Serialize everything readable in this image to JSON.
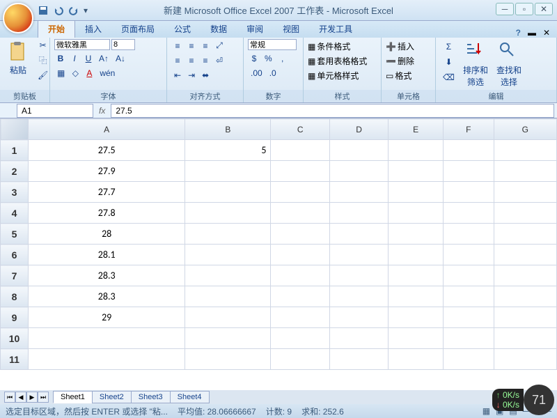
{
  "window": {
    "title": "新建 Microsoft Office Excel 2007 工作表 - Microsoft Excel"
  },
  "tabs": {
    "items": [
      "开始",
      "插入",
      "页面布局",
      "公式",
      "数据",
      "审阅",
      "视图",
      "开发工具"
    ],
    "active": 0
  },
  "ribbon": {
    "clipboard": {
      "label": "剪贴板",
      "paste": "粘贴"
    },
    "font": {
      "label": "字体",
      "name": "微软雅黑",
      "size": "8"
    },
    "align": {
      "label": "对齐方式"
    },
    "number": {
      "label": "数字",
      "format": "常规"
    },
    "styles": {
      "label": "样式",
      "cond": "条件格式",
      "table": "套用表格格式",
      "cell": "单元格样式"
    },
    "cells": {
      "label": "单元格",
      "insert": "插入",
      "delete": "删除",
      "format": "格式"
    },
    "editing": {
      "label": "编辑",
      "sort": "排序和\n筛选",
      "find": "查找和\n选择"
    }
  },
  "namebox": "A1",
  "formula": "27.5",
  "columns": [
    "A",
    "B",
    "C",
    "D",
    "E",
    "F",
    "G"
  ],
  "rows": [
    {
      "n": 1,
      "A": "27.5",
      "B": "5"
    },
    {
      "n": 2,
      "A": "27.9"
    },
    {
      "n": 3,
      "A": "27.7"
    },
    {
      "n": 4,
      "A": "27.8"
    },
    {
      "n": 5,
      "A": "28"
    },
    {
      "n": 6,
      "A": "28.1"
    },
    {
      "n": 7,
      "A": "28.3"
    },
    {
      "n": 8,
      "A": "28.3"
    },
    {
      "n": 9,
      "A": "29"
    },
    {
      "n": 10
    },
    {
      "n": 11
    }
  ],
  "sheets": [
    "Sheet1",
    "Sheet2",
    "Sheet3",
    "Sheet4"
  ],
  "active_sheet": 0,
  "status": {
    "hint": "选定目标区域，然后按 ENTER 或选择 \"粘...",
    "avg_lbl": "平均值:",
    "avg": "28.06666667",
    "count_lbl": "计数:",
    "count": "9",
    "sum_lbl": "求和:",
    "sum": "252.6"
  },
  "overlay": {
    "net1": "0K/s",
    "net2": "0K/s",
    "pct": "71"
  }
}
